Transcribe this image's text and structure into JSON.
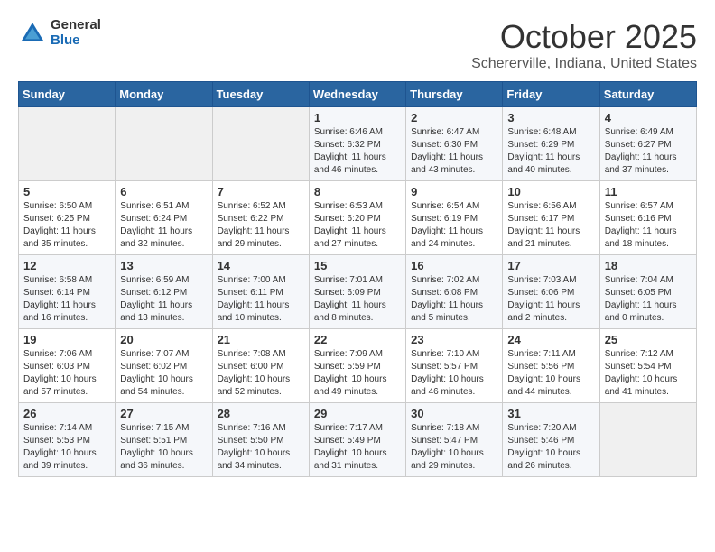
{
  "logo": {
    "general": "General",
    "blue": "Blue"
  },
  "title": "October 2025",
  "subtitle": "Schererville, Indiana, United States",
  "headers": [
    "Sunday",
    "Monday",
    "Tuesday",
    "Wednesday",
    "Thursday",
    "Friday",
    "Saturday"
  ],
  "weeks": [
    [
      {
        "day": "",
        "info": ""
      },
      {
        "day": "",
        "info": ""
      },
      {
        "day": "",
        "info": ""
      },
      {
        "day": "1",
        "info": "Sunrise: 6:46 AM\nSunset: 6:32 PM\nDaylight: 11 hours\nand 46 minutes."
      },
      {
        "day": "2",
        "info": "Sunrise: 6:47 AM\nSunset: 6:30 PM\nDaylight: 11 hours\nand 43 minutes."
      },
      {
        "day": "3",
        "info": "Sunrise: 6:48 AM\nSunset: 6:29 PM\nDaylight: 11 hours\nand 40 minutes."
      },
      {
        "day": "4",
        "info": "Sunrise: 6:49 AM\nSunset: 6:27 PM\nDaylight: 11 hours\nand 37 minutes."
      }
    ],
    [
      {
        "day": "5",
        "info": "Sunrise: 6:50 AM\nSunset: 6:25 PM\nDaylight: 11 hours\nand 35 minutes."
      },
      {
        "day": "6",
        "info": "Sunrise: 6:51 AM\nSunset: 6:24 PM\nDaylight: 11 hours\nand 32 minutes."
      },
      {
        "day": "7",
        "info": "Sunrise: 6:52 AM\nSunset: 6:22 PM\nDaylight: 11 hours\nand 29 minutes."
      },
      {
        "day": "8",
        "info": "Sunrise: 6:53 AM\nSunset: 6:20 PM\nDaylight: 11 hours\nand 27 minutes."
      },
      {
        "day": "9",
        "info": "Sunrise: 6:54 AM\nSunset: 6:19 PM\nDaylight: 11 hours\nand 24 minutes."
      },
      {
        "day": "10",
        "info": "Sunrise: 6:56 AM\nSunset: 6:17 PM\nDaylight: 11 hours\nand 21 minutes."
      },
      {
        "day": "11",
        "info": "Sunrise: 6:57 AM\nSunset: 6:16 PM\nDaylight: 11 hours\nand 18 minutes."
      }
    ],
    [
      {
        "day": "12",
        "info": "Sunrise: 6:58 AM\nSunset: 6:14 PM\nDaylight: 11 hours\nand 16 minutes."
      },
      {
        "day": "13",
        "info": "Sunrise: 6:59 AM\nSunset: 6:12 PM\nDaylight: 11 hours\nand 13 minutes."
      },
      {
        "day": "14",
        "info": "Sunrise: 7:00 AM\nSunset: 6:11 PM\nDaylight: 11 hours\nand 10 minutes."
      },
      {
        "day": "15",
        "info": "Sunrise: 7:01 AM\nSunset: 6:09 PM\nDaylight: 11 hours\nand 8 minutes."
      },
      {
        "day": "16",
        "info": "Sunrise: 7:02 AM\nSunset: 6:08 PM\nDaylight: 11 hours\nand 5 minutes."
      },
      {
        "day": "17",
        "info": "Sunrise: 7:03 AM\nSunset: 6:06 PM\nDaylight: 11 hours\nand 2 minutes."
      },
      {
        "day": "18",
        "info": "Sunrise: 7:04 AM\nSunset: 6:05 PM\nDaylight: 11 hours\nand 0 minutes."
      }
    ],
    [
      {
        "day": "19",
        "info": "Sunrise: 7:06 AM\nSunset: 6:03 PM\nDaylight: 10 hours\nand 57 minutes."
      },
      {
        "day": "20",
        "info": "Sunrise: 7:07 AM\nSunset: 6:02 PM\nDaylight: 10 hours\nand 54 minutes."
      },
      {
        "day": "21",
        "info": "Sunrise: 7:08 AM\nSunset: 6:00 PM\nDaylight: 10 hours\nand 52 minutes."
      },
      {
        "day": "22",
        "info": "Sunrise: 7:09 AM\nSunset: 5:59 PM\nDaylight: 10 hours\nand 49 minutes."
      },
      {
        "day": "23",
        "info": "Sunrise: 7:10 AM\nSunset: 5:57 PM\nDaylight: 10 hours\nand 46 minutes."
      },
      {
        "day": "24",
        "info": "Sunrise: 7:11 AM\nSunset: 5:56 PM\nDaylight: 10 hours\nand 44 minutes."
      },
      {
        "day": "25",
        "info": "Sunrise: 7:12 AM\nSunset: 5:54 PM\nDaylight: 10 hours\nand 41 minutes."
      }
    ],
    [
      {
        "day": "26",
        "info": "Sunrise: 7:14 AM\nSunset: 5:53 PM\nDaylight: 10 hours\nand 39 minutes."
      },
      {
        "day": "27",
        "info": "Sunrise: 7:15 AM\nSunset: 5:51 PM\nDaylight: 10 hours\nand 36 minutes."
      },
      {
        "day": "28",
        "info": "Sunrise: 7:16 AM\nSunset: 5:50 PM\nDaylight: 10 hours\nand 34 minutes."
      },
      {
        "day": "29",
        "info": "Sunrise: 7:17 AM\nSunset: 5:49 PM\nDaylight: 10 hours\nand 31 minutes."
      },
      {
        "day": "30",
        "info": "Sunrise: 7:18 AM\nSunset: 5:47 PM\nDaylight: 10 hours\nand 29 minutes."
      },
      {
        "day": "31",
        "info": "Sunrise: 7:20 AM\nSunset: 5:46 PM\nDaylight: 10 hours\nand 26 minutes."
      },
      {
        "day": "",
        "info": ""
      }
    ]
  ]
}
